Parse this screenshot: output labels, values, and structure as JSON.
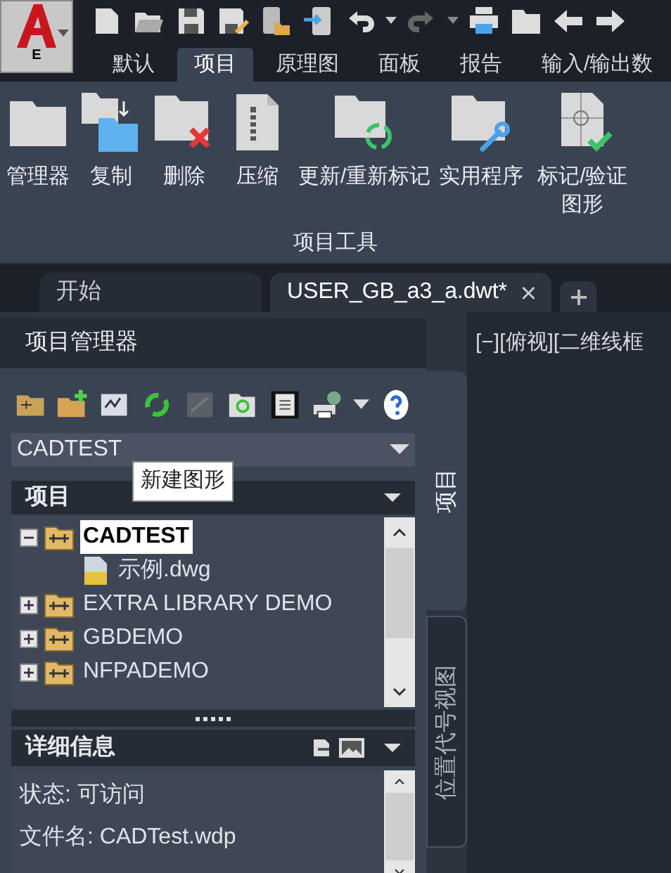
{
  "app_button": {
    "letter": "E"
  },
  "ribbon_tabs": [
    {
      "label": "默认",
      "selected": false
    },
    {
      "label": "项目",
      "selected": true
    },
    {
      "label": "原理图",
      "selected": false
    },
    {
      "label": "面板",
      "selected": false
    },
    {
      "label": "报告",
      "selected": false
    },
    {
      "label": "输入/输出数",
      "selected": false
    }
  ],
  "ribbon_panel": {
    "title": "项目工具",
    "buttons": [
      {
        "label": "管理器",
        "kind": "folder"
      },
      {
        "label": "复制",
        "kind": "copy"
      },
      {
        "label": "删除",
        "kind": "delete"
      },
      {
        "label": "压缩",
        "kind": "zip"
      },
      {
        "label": "更新/重新标记",
        "kind": "refresh"
      },
      {
        "label": "实用程序",
        "kind": "wrench"
      },
      {
        "label": "标记/验证图形",
        "kind": "verify"
      }
    ]
  },
  "document_tabs": [
    {
      "label": "开始",
      "selected": false
    },
    {
      "label": "USER_GB_a3_a.dwt*",
      "selected": true
    }
  ],
  "palette": {
    "title": "项目管理器",
    "project_select": {
      "value": "CADTEST"
    },
    "tooltip": "新建图形",
    "tree_header": "项目",
    "tree": [
      {
        "label": "CADTEST",
        "kind": "project",
        "expanded": true,
        "selected": true,
        "children": [
          {
            "label": "示例.dwg",
            "kind": "drawing",
            "selected": false
          }
        ]
      },
      {
        "label": "EXTRA LIBRARY DEMO",
        "kind": "project",
        "expanded": false,
        "selected": false
      },
      {
        "label": "GBDEMO",
        "kind": "project",
        "expanded": false,
        "selected": false
      },
      {
        "label": "NFPADEMO",
        "kind": "project",
        "expanded": false,
        "selected": false
      }
    ],
    "details_header": "详细信息",
    "details": [
      "状态: 可访问",
      "文件名: CADTest.wdp"
    ]
  },
  "side_tabs": [
    {
      "label": "项目",
      "selected": true
    },
    {
      "label": "位置代号视图",
      "selected": false
    }
  ],
  "viewport": {
    "label": "[−][俯视][二维线框"
  }
}
